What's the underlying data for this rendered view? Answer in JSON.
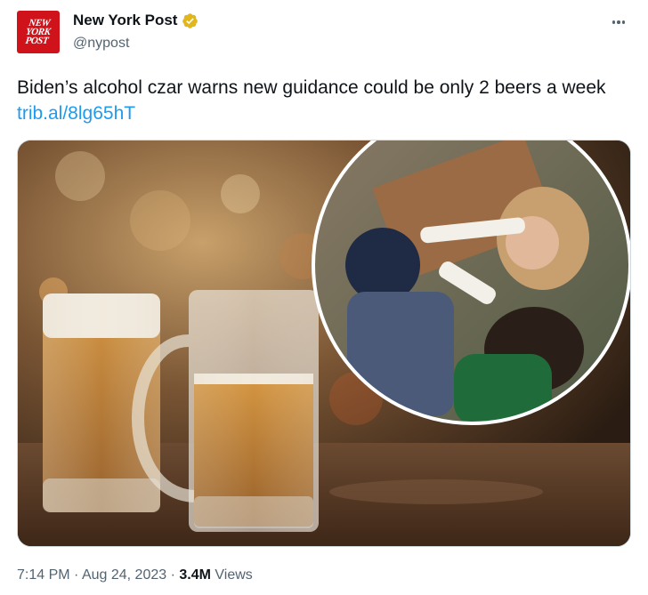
{
  "author": {
    "display_name": "New York Post",
    "handle": "@nypost",
    "avatar_text_lines": [
      "NEW",
      "YORK",
      "POST"
    ],
    "verified": true,
    "verified_color": "#e2b719",
    "brand_color": "#d0121b"
  },
  "tweet": {
    "text": "Biden’s alcohol czar warns new guidance could be only 2 beers a week",
    "link_text": "trib.al/8lg65hT",
    "link_color": "#1d9bf0"
  },
  "media": {
    "icon": "photo"
  },
  "meta": {
    "time": "7:14 PM",
    "separator": "·",
    "date": "Aug 24, 2023",
    "views_count": "3.4M",
    "views_label": "Views"
  },
  "icons": {
    "more": "more-icon",
    "verified": "verified-badge-icon"
  }
}
